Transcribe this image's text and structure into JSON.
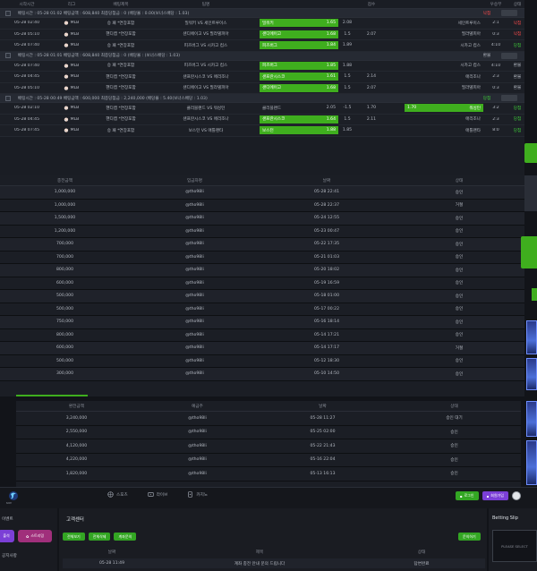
{
  "bet_table": {
    "headers": [
      "시작시간",
      "리그",
      "배팅제목",
      "팀명",
      "점수",
      "우승부",
      "상태",
      "골드뱃"
    ],
    "groups": [
      {
        "summary": "배팅시간 : 05-28 01:02    배팅금액 : 608,840    최종당첨금 : 0   (배당율 : 0.00(보너스배당 : 1.03)",
        "status": "낙첨",
        "status_type": "lose",
        "rows": [
          {
            "time": "05-28 02:40",
            "league": "MLB",
            "title": "승 패 *연장포함",
            "teams": "밀워키  VS  세인트루이스",
            "home": "밀워키",
            "home_odds": "1.65",
            "mid": "2.08",
            "away_odds": "",
            "away": "세인트루이스",
            "score": "2:1",
            "status": "낙첨",
            "status_type": "lose",
            "sel": "home"
          },
          {
            "time": "05-28 05:10",
            "league": "MLB",
            "title": "핸디캡 *연장포함",
            "teams": "샌디에이고  VS  필라델피아",
            "home": "샌디에이고",
            "home_odds": "1.68",
            "mid": "1.5",
            "away_odds": "2.07",
            "away": "필라델피아",
            "score": "0:3",
            "status": "낙첨",
            "status_type": "lose",
            "sel": "home"
          },
          {
            "time": "05-28 07:40",
            "league": "MLB",
            "title": "승 패 *연장포함",
            "teams": "피츠버그  VS  시카고 컵스",
            "home": "피츠버그",
            "home_odds": "1.84",
            "mid": "1.89",
            "away_odds": "",
            "away": "시카고 컵스",
            "score": "4:10",
            "status": "당첨",
            "status_type": "win",
            "sel": "home"
          }
        ]
      },
      {
        "summary": "배팅시간 : 05-28 01:01    배팅금액 : 608,840    최종당첨금 : 0   (배당율 : (보너스배당 : 1.03)",
        "status": "환불",
        "status_type": "tie",
        "rows": [
          {
            "time": "05-28 07:40",
            "league": "MLB",
            "title": "승 패 *연장포함",
            "teams": "피츠버그  VS  시카고 컵스",
            "home": "피츠버그",
            "home_odds": "1.85",
            "mid": "1.88",
            "away_odds": "",
            "away": "시카고 컵스",
            "score": "4:10",
            "status": "환불",
            "status_type": "tie",
            "sel": "home"
          },
          {
            "time": "05-28 04:45",
            "league": "MLB",
            "title": "핸디캡 *연장포함",
            "teams": "샌프란시스코  VS  애리조나",
            "home": "샌프란시스코",
            "home_odds": "1.61",
            "mid": "1.5",
            "away_odds": "2.14",
            "away": "애리조나",
            "score": "2:3",
            "status": "환불",
            "status_type": "tie",
            "sel": "home"
          },
          {
            "time": "05-28 05:10",
            "league": "MLB",
            "title": "핸디캡 *연장포함",
            "teams": "샌디에이고  VS  필라델피아",
            "home": "샌디에이고",
            "home_odds": "1.68",
            "mid": "1.5",
            "away_odds": "2.07",
            "away": "필라델피아",
            "score": "0:3",
            "status": "환불",
            "status_type": "tie",
            "sel": "home"
          }
        ]
      },
      {
        "summary": "배팅시간 : 05-28 00:49    배팅금액 : 600,000    최종당첨금 : 2,240,000   (배당율 : 5.40(보너스배당 : 1.03)",
        "status": "당첨",
        "status_type": "win",
        "rows": [
          {
            "time": "05-28 02:10",
            "league": "MLB",
            "title": "핸디캡 *연장포함",
            "teams": "클리블랜드  VS  워싱턴",
            "home": "클리블랜드",
            "home_odds": "2.05",
            "mid": "-1.5",
            "away_odds": "1.70",
            "away": "워싱턴",
            "score": "3:2",
            "status": "당첨",
            "status_type": "win",
            "sel": "away"
          },
          {
            "time": "05-28 04:45",
            "league": "MLB",
            "title": "핸디캡 *연장포함",
            "teams": "샌프란시스코  VS  애리조나",
            "home": "샌프란시스코",
            "home_odds": "1.64",
            "mid": "1.5",
            "away_odds": "2.11",
            "away": "애리조나",
            "score": "2:3",
            "status": "당첨",
            "status_type": "win",
            "sel": "home"
          },
          {
            "time": "05-28 07:45",
            "league": "MLB",
            "title": "승 패 *연장포함",
            "teams": "보스턴  VS  애틀랜타",
            "home": "보스턴",
            "home_odds": "1.88",
            "mid": "1.85",
            "away_odds": "",
            "away": "애틀랜타",
            "score": "8:0",
            "status": "당첨",
            "status_type": "win",
            "sel": "home"
          }
        ]
      }
    ],
    "cancel_label": "취소"
  },
  "deposit_table": {
    "headers": [
      "충전금액",
      "입금자명",
      "날짜",
      "상태"
    ],
    "rows": [
      [
        "1,000,000",
        "@tho98li",
        "05-28 22:41",
        "승인"
      ],
      [
        "1,000,000",
        "@tho98li",
        "05-28 22:37",
        "거절"
      ],
      [
        "1,500,000",
        "@tho98li",
        "05-24 12:55",
        "승인"
      ],
      [
        "1,200,000",
        "@tho98li",
        "05-23 00:47",
        "승인"
      ],
      [
        "700,000",
        "@tho98li",
        "05-22 17:35",
        "승인"
      ],
      [
        "700,000",
        "@tho98li",
        "05-21 01:03",
        "승인"
      ],
      [
        "800,000",
        "@tho98li",
        "05-20 18:02",
        "승인"
      ],
      [
        "600,000",
        "@tho98li",
        "05-19 16:59",
        "승인"
      ],
      [
        "500,000",
        "@tho98li",
        "05-18 01:00",
        "승인"
      ],
      [
        "500,000",
        "@tho98li",
        "05-17 00:22",
        "승인"
      ],
      [
        "750,000",
        "@tho98li",
        "05-16 18:14",
        "승인"
      ],
      [
        "800,000",
        "@tho98li",
        "05-14 17:21",
        "승인"
      ],
      [
        "600,000",
        "@tho98li",
        "05-14 17:17",
        "거절"
      ],
      [
        "500,000",
        "@tho98li",
        "05-12 18:30",
        "승인"
      ],
      [
        "300,000",
        "@tho98li",
        "05-10 14:50",
        "승인"
      ]
    ]
  },
  "withdraw_table": {
    "headers": [
      "환전금액",
      "예금주",
      "날짜",
      "상태"
    ],
    "rows": [
      [
        "3,240,000",
        "@tho98li",
        "05-28 11:27",
        "승인 대기"
      ],
      [
        "2,550,000",
        "@tho98li",
        "05-25 02:00",
        "승인"
      ],
      [
        "4,120,000",
        "@tho98li",
        "05-22 21:43",
        "승인"
      ],
      [
        "4,220,000",
        "@tho98li",
        "05-16 22:04",
        "승인"
      ],
      [
        "1,820,000",
        "@tho98li",
        "05-13 16:13",
        "승인"
      ]
    ]
  },
  "nav": {
    "logo_text": "BABY",
    "items": [
      {
        "icon": "sports-icon",
        "label": "스포츠"
      },
      {
        "icon": "live-icon",
        "label": "라이브"
      },
      {
        "icon": "casino-icon",
        "label": "카지노"
      }
    ],
    "btn_login": "로그인",
    "btn_register": "회원가입"
  },
  "left_menu": {
    "event_label": "이벤트",
    "btn_attendance": "출석",
    "btn_stream": "스트리밍",
    "notice_label": "공지사항"
  },
  "customer_center": {
    "title": "고객센터",
    "btns": [
      "전체보기",
      "전체삭제",
      "계좌문의"
    ],
    "write_btn": "문의하기",
    "headers": [
      "날짜",
      "제목",
      "상태"
    ],
    "row": [
      "05-28 11:49",
      "계좌 충전 안내 문의 드립니다",
      "답변완료"
    ]
  },
  "betting_slip": {
    "title": "Betting Slip",
    "placeholder": "PLEASE SELECT"
  },
  "colors": {
    "accent_green": "#3fae1e",
    "win": "#3fd13a",
    "lose": "#ff4b4b",
    "purple": "#7b3fd6"
  }
}
